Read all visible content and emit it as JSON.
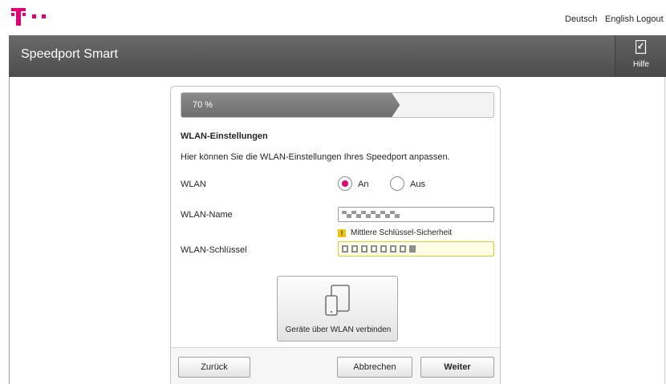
{
  "top_bar": {
    "languages": [
      "Deutsch",
      "English"
    ],
    "logout_label": "Logout",
    "brand_color": "#e20074"
  },
  "header": {
    "title": "Speedport Smart",
    "help_label": "Hilfe",
    "help_icon": "help-book-icon"
  },
  "wizard": {
    "progress": {
      "label": "70 %",
      "percent": 70
    },
    "section_title": "WLAN-Einstellungen",
    "description": "Hier können Sie die WLAN-Einstellungen Ihres Speedport anpassen.",
    "wlan": {
      "label": "WLAN",
      "options": [
        "An",
        "Aus"
      ],
      "selected": "An"
    },
    "wlan_name": {
      "label": "WLAN-Name",
      "value": ""
    },
    "key_strength": {
      "icon": "warning-icon",
      "text": "Mittlere Schlüssel-Sicherheit"
    },
    "wlan_key": {
      "label": "WLAN-Schlüssel",
      "value": ""
    },
    "connect_devices": {
      "label": "Geräte über WLAN verbinden",
      "icon": "devices-icon"
    },
    "buttons": {
      "back": "Zurück",
      "cancel": "Abbrechen",
      "next": "Weiter"
    }
  }
}
